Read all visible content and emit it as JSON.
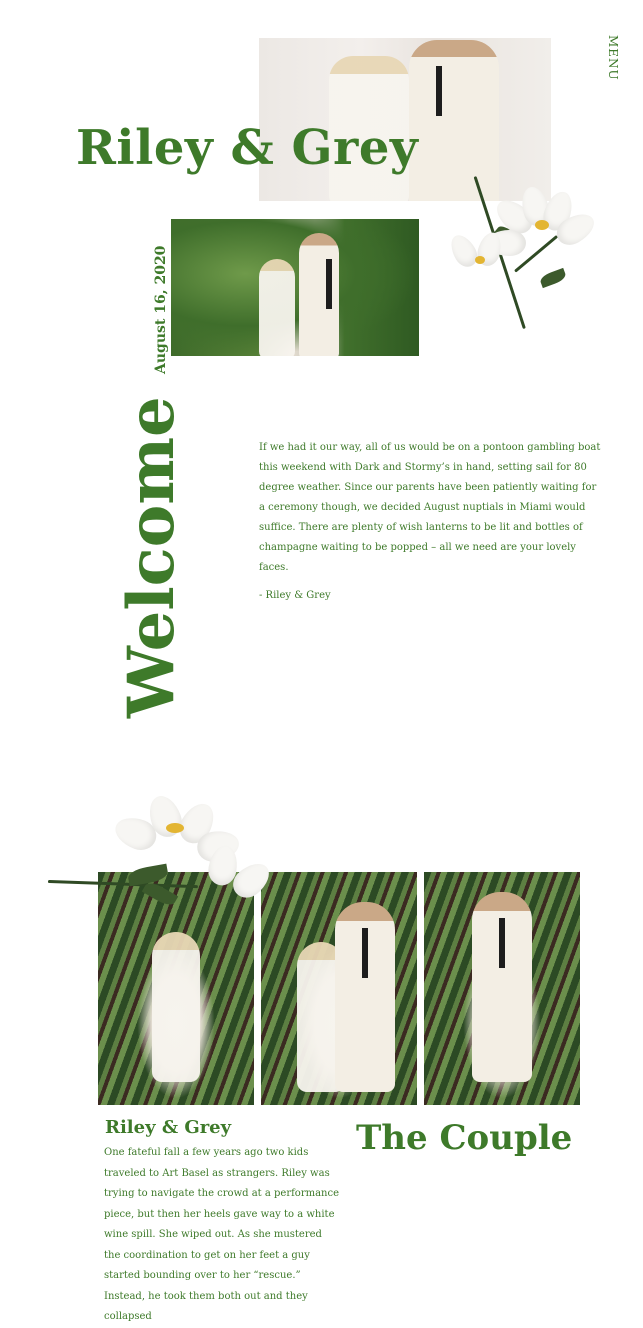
{
  "header": {
    "menu_label": "MENU",
    "title": "Riley & Grey",
    "date": "August 16, 2020"
  },
  "welcome": {
    "heading": "Welcome",
    "body": "If we had it our way, all of us would be on a pontoon gambling boat this weekend with Dark and Stormy’s in hand, setting sail for 80 degree weather. Since our parents have been patiently waiting for a ceremony though, we decided August nuptials in Miami would suffice. There are plenty of wish lanterns to be lit and bottles of champagne waiting to be popped – all we need are your lovely faces.",
    "signature": "- Riley & Grey"
  },
  "couple": {
    "heading": "The Couple",
    "story_title": "Riley & Grey",
    "story_body": "One fateful fall a few years ago two kids traveled to Art Basel as strangers. Riley was trying to navigate the crowd at a performance piece, but then her heels gave way to a white wine spill. She wiped out. As she mustered the coordination to get on her feet a guy started bounding over to her “rescue.” Instead, he took them both out and they collapsed"
  },
  "colors": {
    "accent": "#3e7a2a",
    "background": "#ffffff"
  }
}
